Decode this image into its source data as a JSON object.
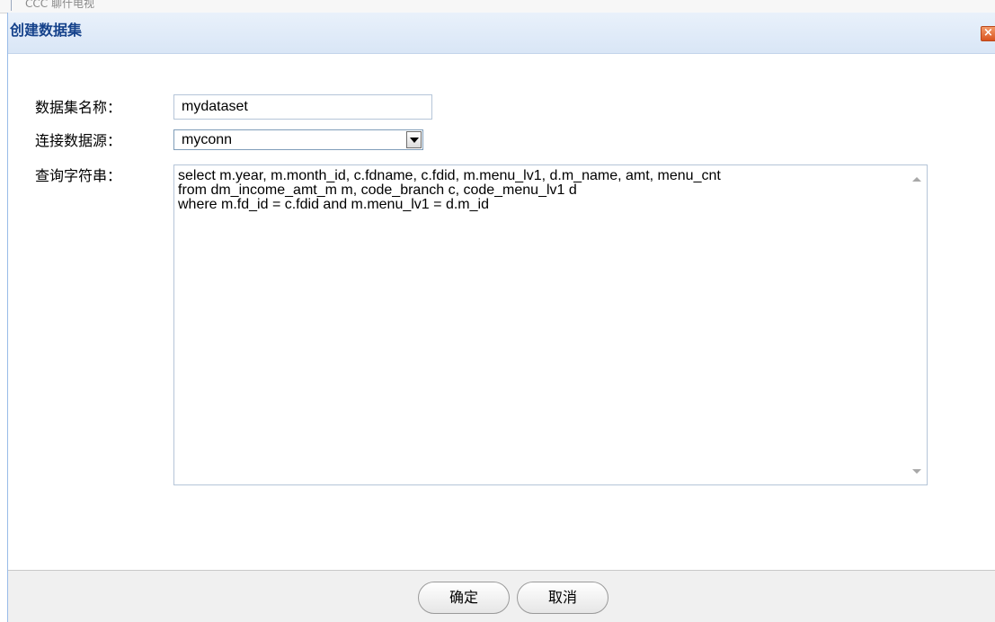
{
  "background": {
    "strip_text": "CCC 聊什电视"
  },
  "dialog": {
    "title": "创建数据集",
    "close_label": "×",
    "fields": {
      "name_label": "数据集名称：",
      "name_value": "mydataset",
      "datasource_label": "连接数据源：",
      "datasource_value": "myconn",
      "query_label": "查询字符串：",
      "query_value": "select m.year, m.month_id, c.fdname, c.fdid, m.menu_lv1, d.m_name, amt, menu_cnt\nfrom dm_income_amt_m m, code_branch c, code_menu_lv1 d\nwhere m.fd_id = c.fdid and m.menu_lv1 = d.m_id"
    },
    "buttons": {
      "ok_label": "确定",
      "cancel_label": "取消"
    }
  },
  "colors": {
    "title_text": "#15428b",
    "close_button": "#d9541e",
    "border": "#99bbe8"
  }
}
